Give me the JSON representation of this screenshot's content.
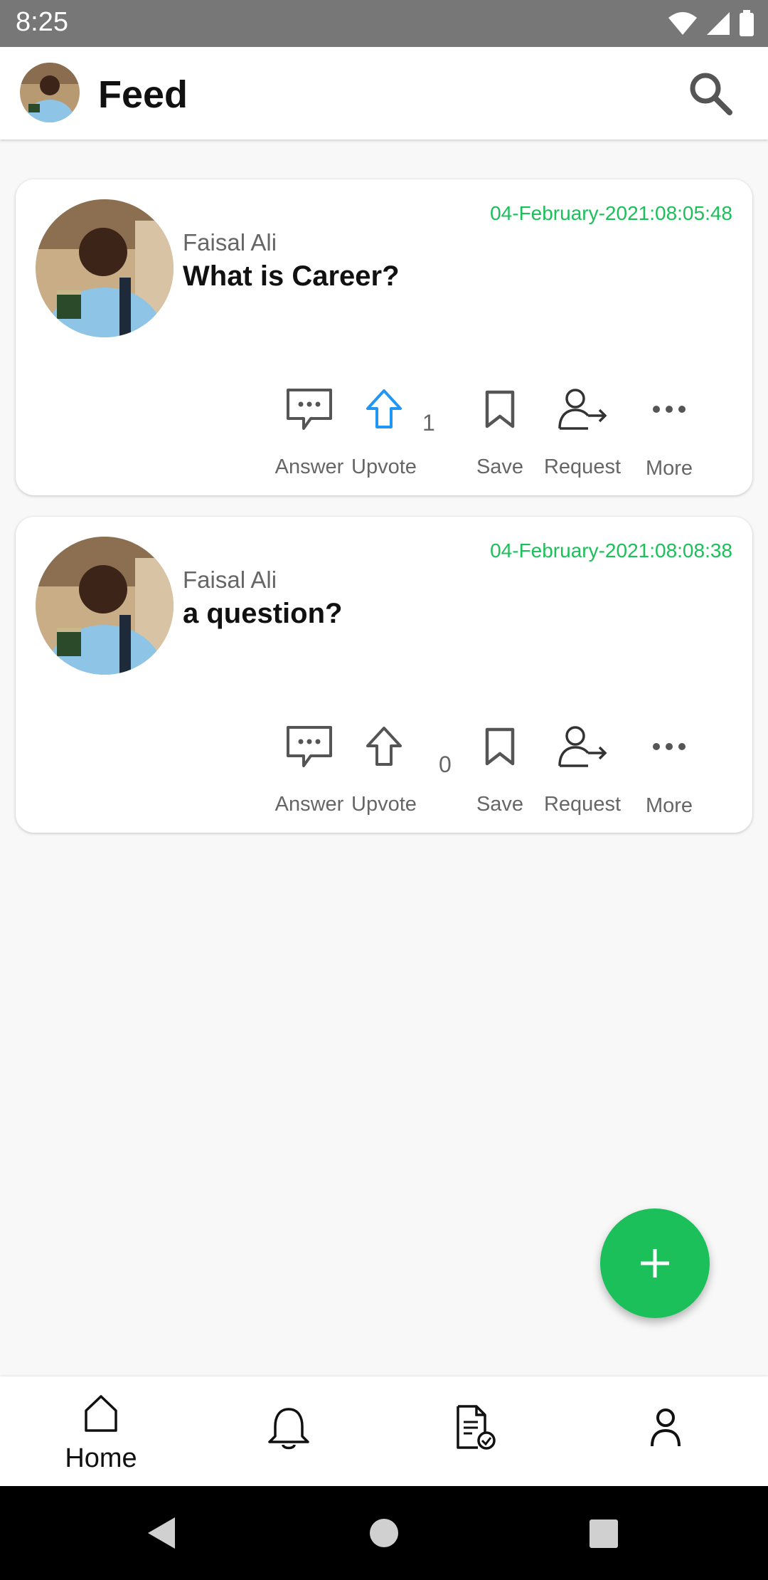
{
  "status_bar": {
    "time": "8:25"
  },
  "app_bar": {
    "title": "Feed"
  },
  "posts": [
    {
      "author": "Faisal Ali",
      "question": "What is Career?",
      "timestamp": "04-February-2021:08:05:48",
      "upvote_count": "1",
      "upvoted": true,
      "actions": {
        "answer": "Answer",
        "upvote": "Upvote",
        "save": "Save",
        "request": "Request",
        "more": "More"
      }
    },
    {
      "author": "Faisal Ali",
      "question": "a question?",
      "timestamp": "04-February-2021:08:08:38",
      "upvote_count": "0",
      "upvoted": false,
      "actions": {
        "answer": "Answer",
        "upvote": "Upvote",
        "save": "Save",
        "request": "Request",
        "more": "More"
      }
    }
  ],
  "bottom_nav": {
    "home_label": "Home"
  },
  "colors": {
    "accent": "#1bc05a",
    "upvote_active": "#2196f3",
    "status_bar": "#777777"
  }
}
